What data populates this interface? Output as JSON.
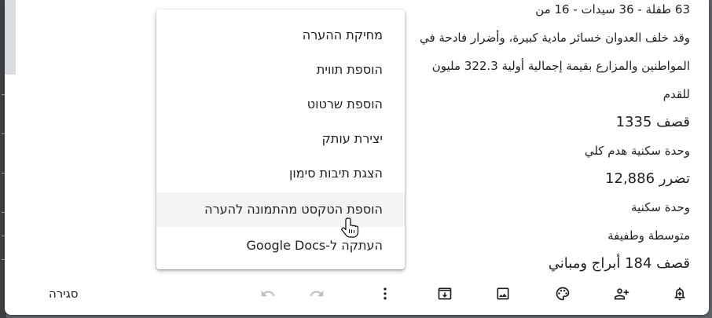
{
  "note": {
    "lines": [
      "63 طفلة - 36 سيدات - 16 من",
      "وقد خلف العدوان خسائر مادية كبيرة، وأضرار فادحة في",
      "المواطنين والمزارع بقيمة إجمالية أولية 322.3 مليون",
      "للقدم",
      "قصف 1335",
      "وحدة سكنية هدم كلي",
      "تضرر 12,886",
      "وحدة سكنية",
      "متوسطة وطفيفة",
      "قصف 184 أبراج ومباني"
    ]
  },
  "context_menu": {
    "items": [
      {
        "label": "מחיקת ההערה"
      },
      {
        "label": "הוספת תווית"
      },
      {
        "label": "הוספת שרטוט"
      },
      {
        "label": "יצירת עותק"
      },
      {
        "label": "הצגת תיבות סימון"
      },
      {
        "label": "הוספת הטקסט מהתמונה להערה"
      },
      {
        "label": "העתקה ל-Google Docs"
      }
    ],
    "hovered_index": 5
  },
  "toolbar": {
    "close_label": "סגירה",
    "icons": {
      "remind": "bell-plus-icon",
      "collaborator": "person-add-icon",
      "color": "palette-icon",
      "image": "image-icon",
      "archive": "archive-icon",
      "more": "more-vert-icon",
      "redo": "redo-icon",
      "undo": "undo-icon"
    }
  },
  "colors": {
    "text": "#202124",
    "disabled_icon": "#bdc1c6",
    "hover_bg": "#f1f3f4",
    "backdrop": "#5f6368"
  }
}
